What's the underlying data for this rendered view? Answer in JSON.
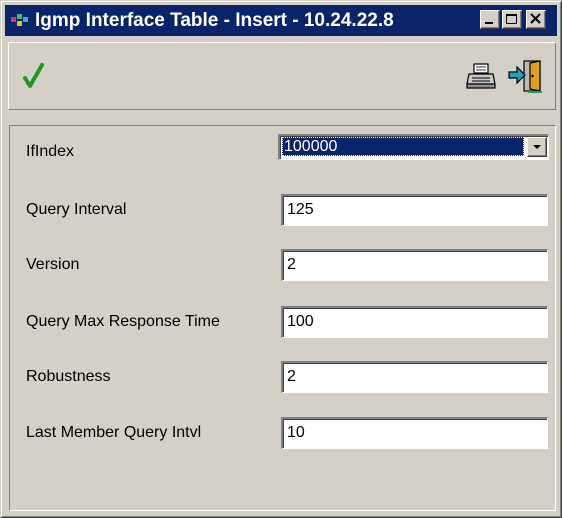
{
  "window": {
    "title": "Igmp Interface Table - Insert - 10.24.22.8",
    "titlebar_color": "#0a246a",
    "controls": [
      "minimize-icon",
      "maximize-icon",
      "close-icon"
    ]
  },
  "toolbar": {
    "buttons": [
      {
        "name": "apply",
        "icon": "checkmark-icon",
        "color": "#1f9a1f"
      },
      {
        "name": "print",
        "icon": "printer-icon"
      },
      {
        "name": "exit",
        "icon": "exit-door-icon"
      }
    ]
  },
  "form": {
    "fields": [
      {
        "label": "IfIndex",
        "value": "100000",
        "type": "select"
      },
      {
        "label": "Query Interval",
        "value": "125",
        "type": "text"
      },
      {
        "label": "Version",
        "value": "2",
        "type": "text"
      },
      {
        "label": "Query Max Response Time",
        "value": "100",
        "type": "text"
      },
      {
        "label": "Robustness",
        "value": "2",
        "type": "text"
      },
      {
        "label": "Last Member Query Intvl",
        "value": "10",
        "type": "text"
      }
    ]
  }
}
